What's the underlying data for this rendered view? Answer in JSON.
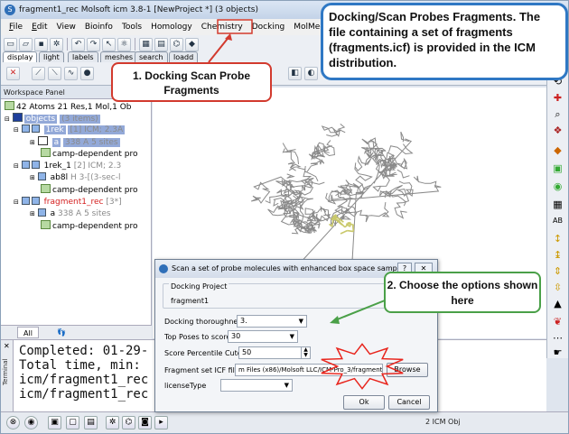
{
  "window": {
    "title": "fragment1_rec Molsoft icm 3.8-1  [NewProject *] (3 objects)",
    "app_icon": "molsoft-app-icon"
  },
  "menu": {
    "items": [
      {
        "label": "File",
        "u": "F"
      },
      {
        "label": "Edit",
        "u": "E"
      },
      {
        "label": "View",
        "u": ""
      },
      {
        "label": "Bioinfo",
        "u": ""
      },
      {
        "label": "Tools",
        "u": ""
      },
      {
        "label": "Homology",
        "u": ""
      },
      {
        "label": "Chemistry",
        "u": ""
      },
      {
        "label": "Docking",
        "u": ""
      },
      {
        "label": "MolMechanics",
        "u": ""
      },
      {
        "label": "Wi",
        "u": ""
      }
    ]
  },
  "tabs": [
    "display",
    "light",
    "labels",
    "meshes",
    "search",
    "loadd"
  ],
  "workspace": {
    "header": "Workspace Panel",
    "summary": "42 Atoms 21 Res,1 Mol,1 Ob",
    "objects_label": "objects",
    "objects_count": "(3 items)",
    "tree": [
      {
        "name": "1rek",
        "detail": "[1] ICM; 2.3A",
        "level": 1,
        "selected": true
      },
      {
        "name": "a",
        "detail": "338 A  5 sites",
        "level": 2,
        "selected": true
      },
      {
        "name": "camp-dependent pro",
        "detail": "",
        "level": 2
      },
      {
        "name": "1rek_1",
        "detail": "[2] ICM; 2.3",
        "level": 1
      },
      {
        "name": "ab8l",
        "detail": "H  3-[(3-sec-l",
        "level": 2
      },
      {
        "name": "camp-dependent pro",
        "detail": "",
        "level": 2
      },
      {
        "name": "fragment1_rec",
        "detail": "[3*]",
        "level": 1,
        "red": true
      },
      {
        "name": "a",
        "detail": "338 A  5 sites",
        "level": 2
      },
      {
        "name": "camp-dependent pro",
        "detail": "",
        "level": 2
      }
    ],
    "bottom_tab": "All"
  },
  "terminal": {
    "label": "Terminal",
    "lines": [
      "Completed:   01-29-",
      "Total time, min: ",
      "icm/fragment1_rec",
      "icm/fragment1_rec"
    ]
  },
  "status": {
    "text": "2 ICM Obj"
  },
  "dialog": {
    "title": "Scan a set of probe molecules with enhanced box space sampling",
    "help": "?",
    "close": "✕",
    "project_group_label": "Docking Project",
    "project_name": "fragment1",
    "fields": {
      "thoroughness_label": "Docking thoroughness",
      "thoroughness_value": "3.",
      "top_poses_label": "Top Poses to score",
      "top_poses_value": "30",
      "cutoff_label": "Score Percentile Cutoff",
      "cutoff_value": "50",
      "icf_label": "Fragment set ICF file",
      "icf_value": "m Files (x86)/Molsoft LLC/ICM-Pro_3/fragments.icf",
      "license_label": "licenseType",
      "license_value": ""
    },
    "browse_label": "Browse",
    "ok_label": "Ok",
    "cancel_label": "Cancel"
  },
  "callouts": {
    "top_text": "Docking/Scan Probes Fragments. The file containing a set of fragments (fragments.icf) is provided in the ICM distribution.",
    "step1": "1. Docking Scan Probe Fragments",
    "step2": "2. Choose the options shown here"
  },
  "colors": {
    "callout_blue": "#2f78c4",
    "callout_red": "#d23a2e",
    "callout_green": "#4aa048",
    "star_red": "#e8241c",
    "selection": "#93a9d8"
  }
}
